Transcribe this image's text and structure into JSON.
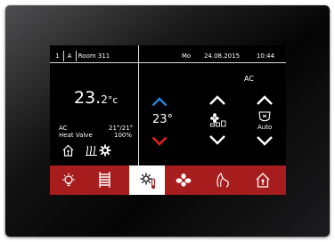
{
  "header": {
    "floor": "1",
    "zone": "A",
    "room": "Room 311",
    "day": "Mo",
    "date": "24.08.2015",
    "time": "10:44"
  },
  "left_panel": {
    "temp_value": "23.",
    "temp_decimal": "2",
    "temp_unit": "°c",
    "mode": "AC",
    "setpoints": "21°/21°",
    "valve_label": "Heat Valve",
    "valve_value": "100%"
  },
  "setpoint": {
    "value": "23°"
  },
  "ac": {
    "label": "AC",
    "mode_label": "Auto"
  },
  "tabs": [
    {
      "icon": "light-bulb-icon"
    },
    {
      "icon": "blinds-icon"
    },
    {
      "icon": "climate-icon"
    },
    {
      "icon": "fan-icon"
    },
    {
      "icon": "scenes-icon"
    },
    {
      "icon": "home-icon"
    }
  ],
  "colors": {
    "screen_bg": "#000000",
    "tab_bar": "#a71d1d",
    "arrow_up": "#2a7fd4",
    "arrow_down": "#e02020"
  }
}
